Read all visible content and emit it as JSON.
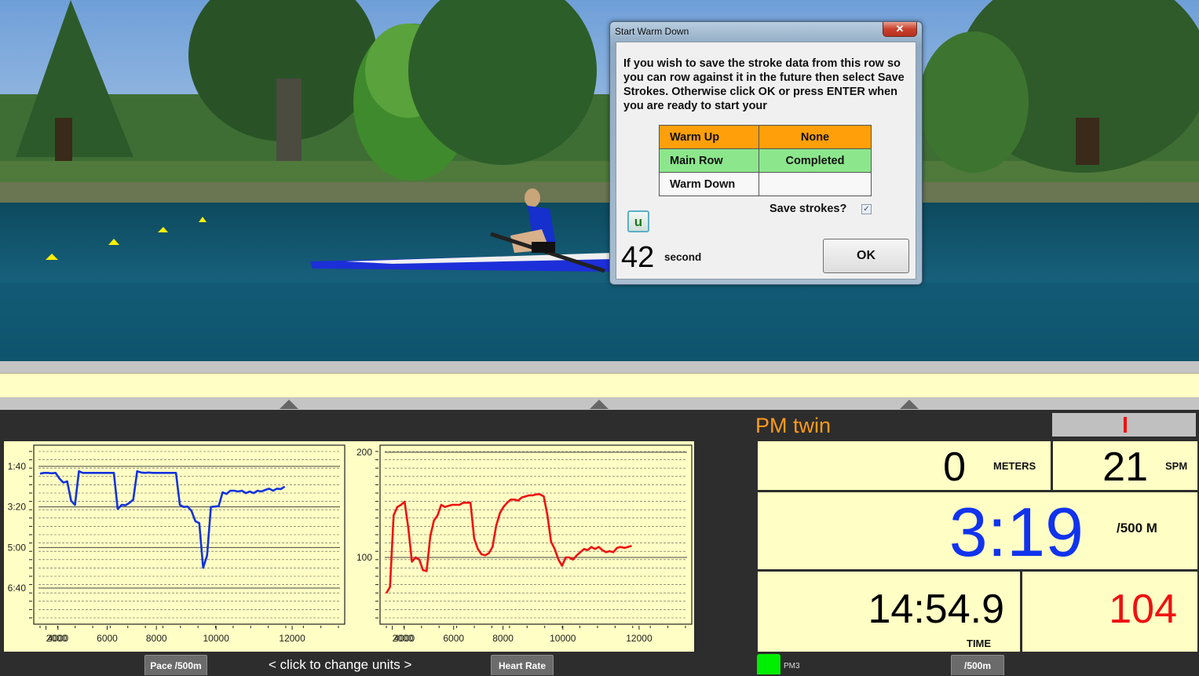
{
  "dialog": {
    "title": "Start Warm Down",
    "close_glyph": "✕",
    "message": "If you wish to save the stroke data from this row so you can row against it in the future then select Save Strokes.  Otherwise click OK or press ENTER when you are ready to start your",
    "status_rows": [
      {
        "label": "Warm Up",
        "value": "None",
        "color": "#ff9f0a"
      },
      {
        "label": "Main Row",
        "value": "Completed",
        "color": "#8ce68c"
      },
      {
        "label": "Warm Down",
        "value": "",
        "color": "#f8f8f8"
      }
    ],
    "save_strokes_label": "Save strokes?",
    "save_strokes_checked": true,
    "check_glyph": "✓",
    "u_button_label": "u",
    "countdown_value": "42",
    "countdown_unit": "second",
    "ok_label": "OK"
  },
  "charts_panel": {
    "pace_units_button": "Pace /500m",
    "hr_units_button": "Heart Rate",
    "change_units_label": "<  click to change units  >"
  },
  "monitor": {
    "title": "PM twin",
    "meters_value": "0",
    "meters_unit": "METERS",
    "spm_value": "21",
    "spm_unit": "SPM",
    "pace_value": "3:19",
    "pace_unit": "/500 M",
    "time_value": "14:54.9",
    "time_unit": "TIME",
    "heart_rate_value": "104",
    "pm_label": "PM3",
    "units_button": "/500m",
    "colors": {
      "title": "#ff9a1a",
      "pace": "#1133ee",
      "heart_rate": "#ee1111",
      "connected": "#00ee00"
    }
  },
  "chart_data": [
    {
      "type": "line",
      "name": "pace",
      "title": "",
      "xlabel": "",
      "ylabel": "Pace /500m",
      "y_inverted": true,
      "ylim_seconds": [
        60,
        500
      ],
      "yticks": [
        {
          "label": "1:40",
          "seconds": 100
        },
        {
          "label": "3:20",
          "seconds": 200
        },
        {
          "label": "5:00",
          "seconds": 300
        },
        {
          "label": "6:40",
          "seconds": 400
        }
      ],
      "xtick_labels": [
        "2000",
        "4000",
        "6000",
        "8000",
        "10000",
        "12000"
      ],
      "grid": true,
      "series": [
        {
          "name": "Pace",
          "color": "#1133dd",
          "points_seconds": [
            118,
            116,
            116,
            117,
            116,
            130,
            140,
            137,
            185,
            195,
            112,
            116,
            116,
            116,
            116,
            116,
            116,
            116,
            116,
            116,
            205,
            195,
            196,
            190,
            182,
            112,
            115,
            116,
            115,
            116,
            116,
            116,
            116,
            116,
            116,
            116,
            195,
            200,
            199,
            210,
            235,
            240,
            350,
            320,
            200,
            199,
            198,
            164,
            168,
            160,
            160,
            162,
            160,
            166,
            162,
            166,
            160,
            162,
            158,
            155,
            160,
            155,
            156,
            150
          ]
        }
      ]
    },
    {
      "type": "line",
      "name": "heart_rate",
      "title": "",
      "xlabel": "",
      "ylabel": "Heart Rate",
      "ylim": [
        40,
        203
      ],
      "yticks": [
        100,
        200
      ],
      "xtick_labels": [
        "2000",
        "4000",
        "6000",
        "8000",
        "10000",
        "12000"
      ],
      "grid": true,
      "series": [
        {
          "name": "Heart Rate",
          "color": "#ee1111",
          "points": [
            66,
            72,
            140,
            148,
            150,
            153,
            128,
            96,
            100,
            98,
            88,
            87,
            120,
            135,
            140,
            150,
            148,
            149,
            150,
            150,
            150,
            152,
            152,
            152,
            118,
            108,
            103,
            102,
            104,
            110,
            130,
            142,
            148,
            152,
            155,
            155,
            154,
            157,
            158,
            159,
            159,
            160,
            160,
            158,
            140,
            115,
            108,
            98,
            92,
            100,
            100,
            98,
            102,
            105,
            108,
            107,
            110,
            108,
            110,
            107,
            105,
            106,
            105,
            109,
            110,
            109,
            110,
            111
          ]
        }
      ]
    }
  ]
}
